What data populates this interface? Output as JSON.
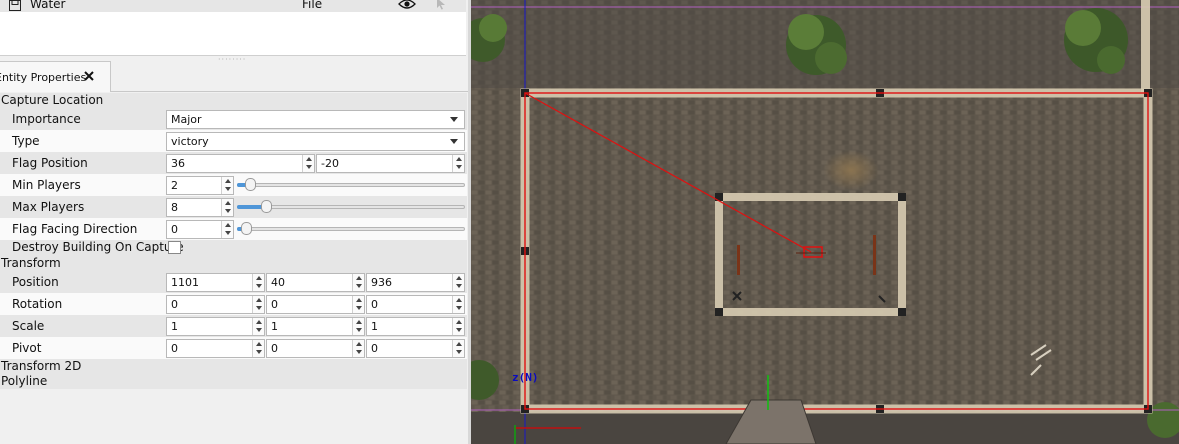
{
  "layers": {
    "items": [
      {
        "name": "Water",
        "type": "File",
        "visibility_icon": "eye-icon",
        "select_icon": "cursor-icon"
      }
    ]
  },
  "tabs": [
    {
      "label": "Entity Properties",
      "close_icon": "close-icon"
    }
  ],
  "properties": {
    "capture_location": {
      "header": "Capture Location",
      "importance": {
        "label": "Importance",
        "value": "Major"
      },
      "type": {
        "label": "Type",
        "value": "victory"
      },
      "flag_position": {
        "label": "Flag Position",
        "x": "36",
        "y": "-20"
      },
      "min_players": {
        "label": "Min Players",
        "value": "2",
        "slider_fraction": 0.02
      },
      "max_players": {
        "label": "Max Players",
        "value": "8",
        "slider_fraction": 0.09
      },
      "flag_facing": {
        "label": "Flag Facing Direction",
        "value": "0",
        "slider_fraction": 0.0
      },
      "destroy_building": {
        "label": "Destroy Building On Capture",
        "checked": false
      }
    },
    "transform": {
      "header": "Transform",
      "position": {
        "label": "Position",
        "x": "1101",
        "y": "40",
        "z": "936"
      },
      "rotation": {
        "label": "Rotation",
        "x": "0",
        "y": "0",
        "z": "0"
      },
      "scale": {
        "label": "Scale",
        "x": "1",
        "y": "1",
        "z": "1"
      },
      "pivot": {
        "label": "Pivot",
        "x": "0",
        "y": "0",
        "z": "0"
      }
    },
    "transform2d": {
      "header": "Transform 2D"
    },
    "polyline": {
      "header": "Polyline"
    }
  },
  "viewport": {
    "axis_label": "z(N)",
    "colors": {
      "ground": "#625a4f",
      "wall": "#cfc2a8",
      "selection": "#e01010",
      "axis": "#1010c0"
    }
  }
}
